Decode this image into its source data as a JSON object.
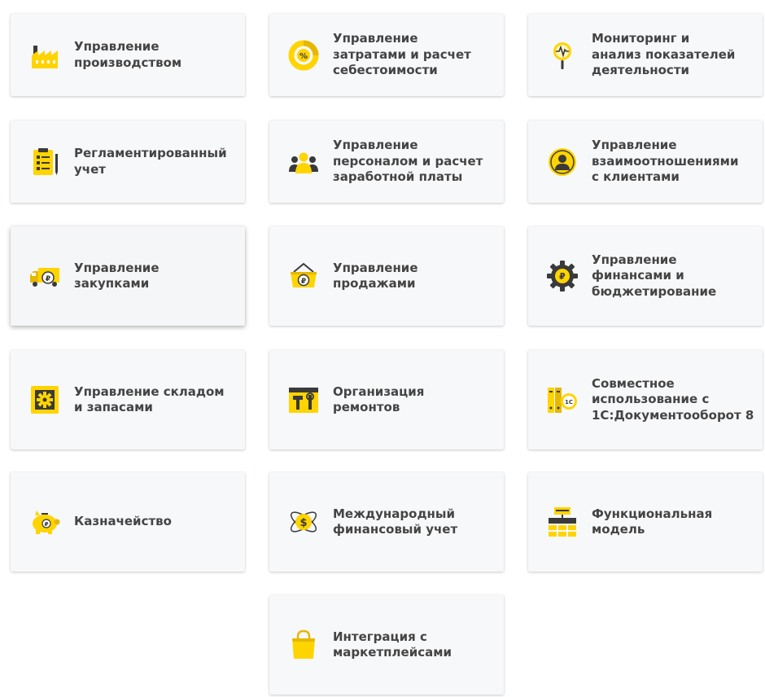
{
  "colors": {
    "accent": "#ffd400",
    "accent_dark": "#e6b800",
    "icon_dark": "#3a3a3a",
    "text": "#444444",
    "card_bg": "#f7f8fa"
  },
  "cards": [
    {
      "label": "Управление\nпроизводством",
      "icon": "factory-icon"
    },
    {
      "label": "Управление\nзатратами и расчет\nсебестоимости",
      "icon": "percent-donut-icon"
    },
    {
      "label": "Мониторинг и\nанализ показателей\nдеятельности",
      "icon": "magnifier-pulse-icon"
    },
    {
      "label": "Регламентированный\nучет",
      "icon": "clipboard-checklist-icon"
    },
    {
      "label": "Управление\nперсоналом и расчет\nзаработной платы",
      "icon": "people-group-icon"
    },
    {
      "label": "Управление\nвзаимоотношениями\nс клиентами",
      "icon": "customer-avatar-icon"
    },
    {
      "label": "Управление\nзакупками",
      "icon": "truck-ruble-icon"
    },
    {
      "label": "Управление\nпродажами",
      "icon": "basket-ruble-icon"
    },
    {
      "label": "Управление\nфинансами и\nбюджетирование",
      "icon": "gear-ruble-icon"
    },
    {
      "label": "Управление складом\nи запасами",
      "icon": "warehouse-gear-icon"
    },
    {
      "label": "Организация\nремонтов",
      "icon": "repair-tools-icon"
    },
    {
      "label": "Совместное\nиспользование с\n1С:Документооборот 8",
      "icon": "document-binders-icon"
    },
    {
      "label": "Казначейство",
      "icon": "piggy-bank-icon"
    },
    {
      "label": "Международный\nфинансовый учет",
      "icon": "globe-dollar-icon"
    },
    {
      "label": "Функциональная\nмодель",
      "icon": "hierarchy-model-icon"
    },
    {
      "label": "Интеграция с\nмаркетплейсами",
      "icon": "shopping-bag-icon"
    }
  ]
}
